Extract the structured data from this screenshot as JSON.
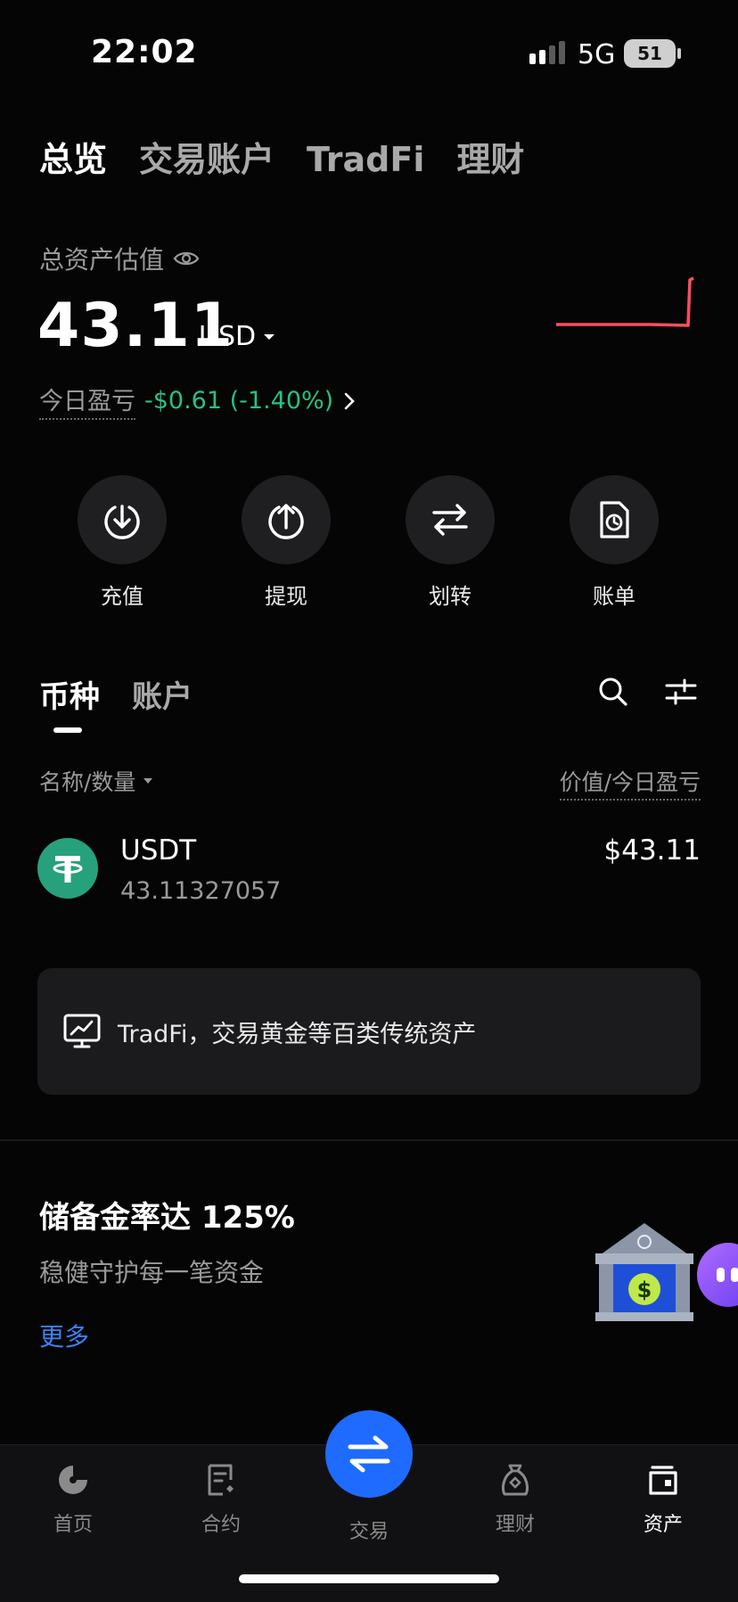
{
  "status_bar": {
    "time": "22:02",
    "network": "5G",
    "battery": "51"
  },
  "top_tabs": [
    {
      "label": "总览",
      "active": true
    },
    {
      "label": "交易账户",
      "active": false
    },
    {
      "label": "TradFi",
      "active": false
    },
    {
      "label": "理财",
      "active": false
    }
  ],
  "overview": {
    "estimate_label": "总资产估值",
    "amount": "43.11",
    "currency": "USD",
    "pnl_label": "今日盈亏",
    "pnl_value": "-$0.61 (-1.40%)",
    "pnl_color": "#26c281",
    "spark_color": "#ff4d5e"
  },
  "actions": [
    {
      "label": "充值",
      "icon": "deposit-icon"
    },
    {
      "label": "提现",
      "icon": "withdraw-icon"
    },
    {
      "label": "划转",
      "icon": "transfer-icon"
    },
    {
      "label": "账单",
      "icon": "bill-icon"
    }
  ],
  "asset_tabs": [
    {
      "label": "币种",
      "active": true
    },
    {
      "label": "账户",
      "active": false
    }
  ],
  "columns": {
    "left": "名称/数量",
    "right": "价值/今日盈亏"
  },
  "assets": [
    {
      "symbol": "USDT",
      "quantity": "43.11327057",
      "value": "$43.11",
      "logo_color": "#26a17b"
    }
  ],
  "tradfi_banner": {
    "text": "TradFi，交易黄金等百类传统资产",
    "icon": "chart-board-icon"
  },
  "reserve": {
    "title": "储备金率达 125%",
    "subtitle": "稳健守护每一笔资金",
    "more": "更多",
    "more_color": "#3b82f6"
  },
  "bottom_nav": [
    {
      "label": "首页",
      "icon": "home-icon",
      "active": false
    },
    {
      "label": "合约",
      "icon": "contract-icon",
      "active": false
    },
    {
      "label": "交易",
      "icon": "trade-icon",
      "active": false
    },
    {
      "label": "理财",
      "icon": "earn-icon",
      "active": false
    },
    {
      "label": "资产",
      "icon": "wallet-icon",
      "active": true
    }
  ],
  "accent_color": "#1f6bff"
}
